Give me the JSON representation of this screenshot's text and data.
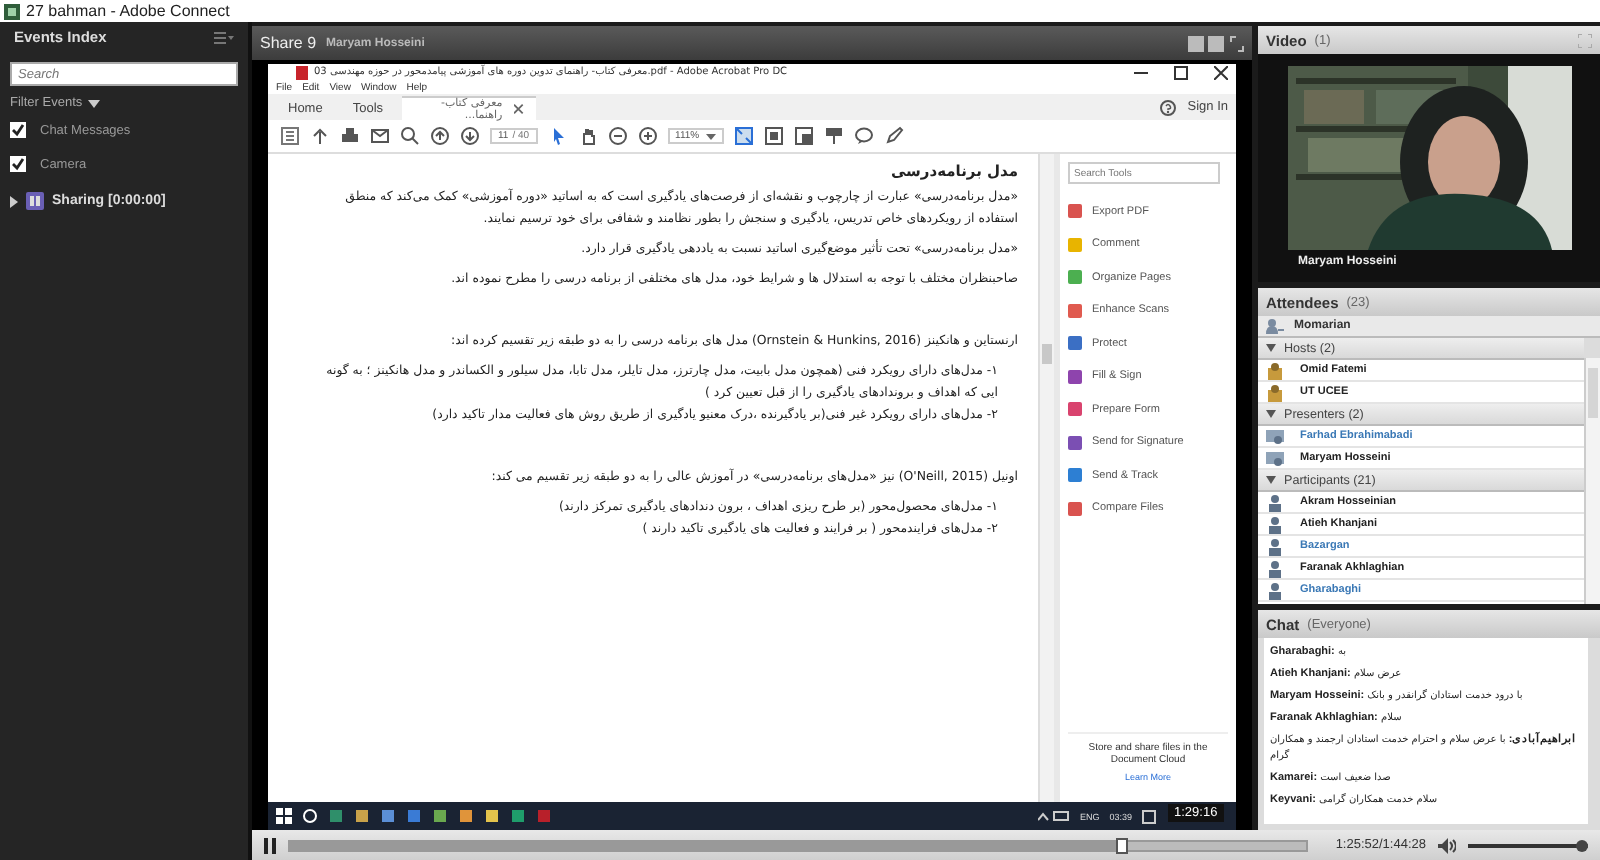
{
  "app": {
    "title": "27 bahman - Adobe Connect"
  },
  "events_index": {
    "title": "Events Index",
    "search": {
      "placeholder": "Search"
    },
    "filter": "Filter Events",
    "filters": [
      {
        "label": "Chat Messages",
        "checked": true
      },
      {
        "label": "Camera",
        "checked": true
      }
    ],
    "events": [
      {
        "label": "Sharing [0:00:00]",
        "expanded": false
      }
    ]
  },
  "share_pod": {
    "title": "Share 9",
    "presenter": "Maryam Hosseini",
    "acrobat": {
      "title": "معرفی کتاب- راهنمای تدوین دوره های آموزشی پیامدمحور در حوزه مهندسی 03.pdf - Adobe Acrobat Pro DC",
      "menu": [
        "File",
        "Edit",
        "View",
        "Window",
        "Help"
      ],
      "tabs": [
        {
          "label": "Home",
          "selected": false
        },
        {
          "label": "Tools",
          "selected": false
        },
        {
          "label": "معرفی کتاب- راهنما...",
          "selected": true
        }
      ],
      "sign_in": "Sign In",
      "page": "11",
      "pages": "/ 40",
      "zoom": "111%",
      "document": {
        "heading": "مدل برنامه‌درسی",
        "sections": [
          {
            "blocks": [
              {
                "kind": "para",
                "text": "«مدل برنامه‌درسی» عبارت از چارچوب و نقشه‌ای از فرصت‌های یادگیری است که به اساتید «دوره آموزشی» کمک می‌کند که منطق استفاده از رویکردهای خاص تدریس، یادگیری و سنجش را بطور نظامند و شفافی برای خود ترسیم نمایند."
              },
              {
                "kind": "para",
                "text": "«مدل برنامه‌درسی» تحت تأثیر موضع‌گیری اساتید نسبت به یاددهی یادگیری قرار دارد."
              },
              {
                "kind": "para",
                "text": "صاحبنظران مختلف با توجه به استدلال ها و شرایط خود، مدل های مختلفی از برنامه درسی را مطرح نموده اند."
              }
            ]
          },
          {
            "blocks": [
              {
                "kind": "para",
                "text": "ارنستاین و هانکینز (Ornstein & Hunkins, 2016) مدل های برنامه درسی را به دو طبقه زیر تقسیم کرده اند:"
              },
              {
                "kind": "item",
                "text": "۱- مدل‌های دارای رویکرد فنی (همچون مدل بابیت، مدل چارترز، مدل تایلر، مدل تابا، مدل سیلور و الکساندر و مدل هانکینز ؛ به گونه ایی که اهداف و بروندادهای یادگیری را از قبل تعیین کرد )"
              },
              {
                "kind": "item",
                "text": "۲- مدل‌های دارای رویکرد غیر فنی(بر یادگیرنده ،درک معنیو یادگیری از طریق روش های فعالیت مدار تاکید دارد)"
              }
            ]
          },
          {
            "blocks": [
              {
                "kind": "para",
                "text": "اونیل (O'Neill, 2015) نیز «مدل‌های برنامه‌درسی» در آموزش عالی را به دو طبقه زیر تقسیم می کند:"
              },
              {
                "kind": "item",
                "text": "۱- مدل‌های محصول‌محور (بر طرح ریزی اهداف ، برون دندادهای یادگیری تمرکز دارند)"
              },
              {
                "kind": "item",
                "text": "۲- مدل‌های فرایندمحور ( بر فرایند و فعالیت های یادگیری تاکید دارند )"
              }
            ]
          }
        ]
      },
      "tools_search": {
        "placeholder": "Search Tools"
      },
      "tools": [
        {
          "label": "Export PDF",
          "color": "#d9534f"
        },
        {
          "label": "Comment",
          "color": "#e8b400"
        },
        {
          "label": "Organize Pages",
          "color": "#4caf50"
        },
        {
          "label": "Enhance Scans",
          "color": "#e05a4f"
        },
        {
          "label": "Protect",
          "color": "#3b6fc4"
        },
        {
          "label": "Fill & Sign",
          "color": "#8e44ad"
        },
        {
          "label": "Prepare Form",
          "color": "#d9436e"
        },
        {
          "label": "Send for Signature",
          "color": "#7b4fb3"
        },
        {
          "label": "Send & Track",
          "color": "#2d7fd3"
        },
        {
          "label": "Compare Files",
          "color": "#d9534f"
        }
      ],
      "cloud_note": "Store and share files in the Document Cloud",
      "learn_more": "Learn More"
    },
    "taskbar": {
      "language": "ENG",
      "clock": "03:39"
    }
  },
  "video": {
    "title": "Video",
    "count": "(1)",
    "feed": {
      "kind": "picture",
      "caption": "Maryam Hosseini"
    }
  },
  "attendees": {
    "title": "Attendees",
    "count": "(23)",
    "me": "Momarian",
    "groups": [
      {
        "label": "Hosts (2)",
        "kind": "host",
        "expanded": true,
        "members": [
          {
            "name": "Omid Fatemi",
            "color": "#222222"
          },
          {
            "name": "UT UCEE",
            "color": "#222222"
          }
        ]
      },
      {
        "label": "Presenters (2)",
        "kind": "presenter",
        "expanded": true,
        "members": [
          {
            "name": "Farhad Ebrahimabadi",
            "color": "#3a78b5"
          },
          {
            "name": "Maryam Hosseini",
            "color": "#222222"
          }
        ]
      },
      {
        "label": "Participants (21)",
        "kind": "participant",
        "expanded": true,
        "members": [
          {
            "name": "Akram Hosseinian",
            "color": "#222222"
          },
          {
            "name": "Atieh Khanjani",
            "color": "#222222"
          },
          {
            "name": "Bazargan",
            "color": "#3a78b5"
          },
          {
            "name": "Faranak Akhlaghian",
            "color": "#222222"
          },
          {
            "name": "Gharabaghi",
            "color": "#3a78b5"
          }
        ]
      }
    ]
  },
  "chat": {
    "title": "Chat",
    "scope": "(Everyone)",
    "messages": [
      {
        "sender": "Gharabaghi:",
        "text": "به"
      },
      {
        "sender": "Atieh Khanjani:",
        "text": "عرض سلام"
      },
      {
        "sender": "Maryam Hosseini:",
        "text": "با درود خدمت استادان گرانقدر و بانک"
      },
      {
        "sender": "Faranak Akhlaghian:",
        "text": "سلام"
      },
      {
        "sender": "ابراهیم‌آبادی:",
        "text": "با عرض سلام و احترام خدمت استادان ارجمند و همکاران گرام"
      },
      {
        "sender": "Kamarei:",
        "text": "صدا ضعیف است"
      },
      {
        "sender": "Keyvani:",
        "text": "سلام خدمت همکاران گرامی"
      }
    ]
  },
  "playback": {
    "playing": true,
    "level": 0.82,
    "hover_time": "1:29:16",
    "time": "1:25:52/1:44:28",
    "volume": {
      "level": 0.95
    }
  }
}
